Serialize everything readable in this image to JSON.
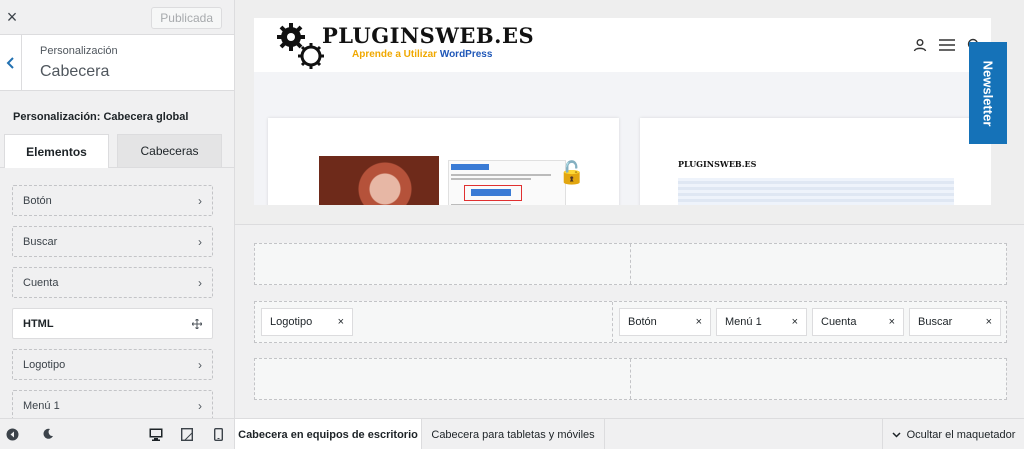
{
  "sidebar": {
    "close_icon": "×",
    "published_label": "Publicada",
    "breadcrumb": "Personalización",
    "title": "Cabecera",
    "section_title": "Personalización: Cabecera global",
    "tabs": [
      {
        "label": "Elementos"
      },
      {
        "label": "Cabeceras"
      }
    ],
    "items": [
      {
        "label": "Botón",
        "icon": "chevron-right"
      },
      {
        "label": "Buscar",
        "icon": "chevron-right"
      },
      {
        "label": "Cuenta",
        "icon": "chevron-right"
      },
      {
        "label": "HTML",
        "icon": "move"
      },
      {
        "label": "Logotipo",
        "icon": "chevron-right"
      },
      {
        "label": "Menú 1",
        "icon": "chevron-right"
      }
    ]
  },
  "preview": {
    "logo_title": "PLUGINSWEB.ES",
    "logo_tag_a": "Aprende a Utilizar ",
    "logo_tag_b": "WordPress",
    "mini_logo": "PLUGINSWEB.ES",
    "newsletter_label": "Newsletter",
    "newsletter_color": "#1572b8"
  },
  "builder": {
    "row2_left": [
      {
        "label": "Logotipo"
      }
    ],
    "row2_right": [
      {
        "label": "Botón"
      },
      {
        "label": "Menú 1"
      },
      {
        "label": "Cuenta"
      },
      {
        "label": "Buscar"
      }
    ],
    "remove_glyph": "×"
  },
  "footer": {
    "tab_desktop": "Cabecera en equipos de escritorio",
    "tab_mobile": "Cabecera para tabletas y móviles",
    "hide_label": "Ocultar el maquetador"
  }
}
